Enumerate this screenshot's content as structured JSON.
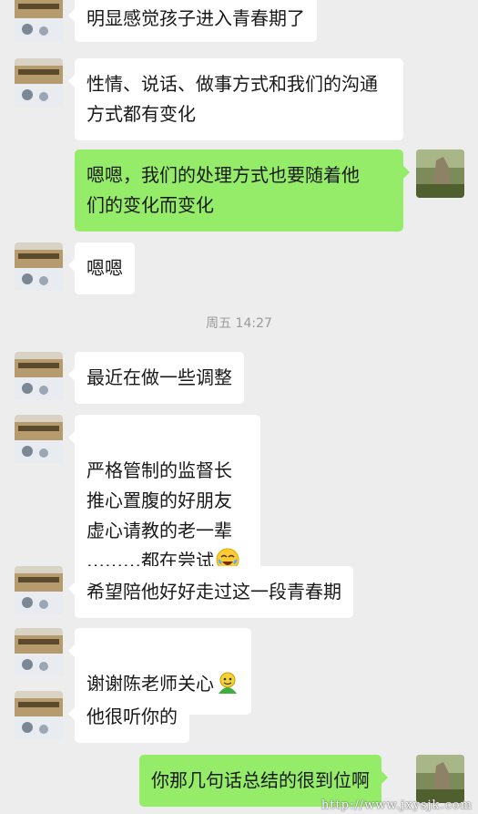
{
  "chat": {
    "timestamp": "周五 14:27",
    "messages": [
      {
        "side": "left",
        "text": "明显感觉孩子进入青春期了"
      },
      {
        "side": "left",
        "text": "性情、说话、做事方式和我们的沟通\n方式都有变化"
      },
      {
        "side": "right",
        "text": "嗯嗯，我们的处理方式也要随着他\n们的变化而变化"
      },
      {
        "side": "left",
        "text": "嗯嗯"
      },
      {
        "side": "left",
        "text": "最近在做一些调整"
      },
      {
        "side": "left",
        "text": "严格管制的监督长\n推心置腹的好朋友\n虚心请教的老一辈\n………都在尝试",
        "emoji": "crying-laugh-emoji"
      },
      {
        "side": "left",
        "text": "希望陪他好好走过这一段青春期"
      },
      {
        "side": "left",
        "text": "谢谢陈老师关心",
        "emoji": "green-face-emoji"
      },
      {
        "side": "left",
        "text": "他很听你的"
      },
      {
        "side": "right",
        "text": "你那几句话总结的很到位啊"
      }
    ]
  },
  "watermark": "http://www.jxysjk.com",
  "colors": {
    "background": "#ededed",
    "incoming_bubble": "#ffffff",
    "outgoing_bubble": "#95ec69"
  }
}
